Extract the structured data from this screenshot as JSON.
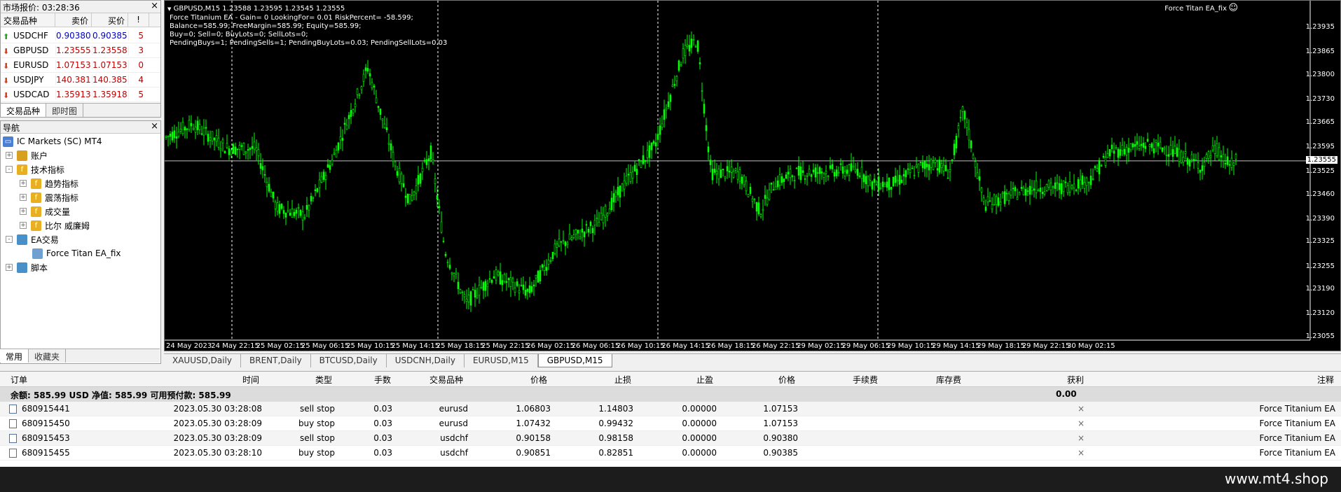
{
  "market_watch": {
    "title": "市场报价: 03:28:36",
    "headers": {
      "symbol": "交易品种",
      "bid": "卖价",
      "ask": "买价",
      "spread": "!"
    },
    "rows": [
      {
        "symbol": "USDCHF",
        "bid": "0.90380",
        "ask": "0.90385",
        "spread": "5",
        "dir": "up"
      },
      {
        "symbol": "GBPUSD",
        "bid": "1.23555",
        "ask": "1.23558",
        "spread": "3",
        "dir": "down"
      },
      {
        "symbol": "EURUSD",
        "bid": "1.07153",
        "ask": "1.07153",
        "spread": "0",
        "dir": "down"
      },
      {
        "symbol": "USDJPY",
        "bid": "140.381",
        "ask": "140.385",
        "spread": "4",
        "dir": "down"
      },
      {
        "symbol": "USDCAD",
        "bid": "1.35913",
        "ask": "1.35918",
        "spread": "5",
        "dir": "down"
      }
    ],
    "tabs": [
      "交易品种",
      "即时图"
    ]
  },
  "navigator": {
    "title": "导航",
    "items": [
      {
        "label": "IC Markets (SC) MT4",
        "level": 0
      },
      {
        "label": "账户",
        "level": 1
      },
      {
        "label": "技术指标",
        "level": 1
      },
      {
        "label": "趋势指标",
        "level": 2
      },
      {
        "label": "震荡指标",
        "level": 2
      },
      {
        "label": "成交量",
        "level": 2
      },
      {
        "label": "比尔 威廉姆",
        "level": 2
      },
      {
        "label": "EA交易",
        "level": 1
      },
      {
        "label": "Force Titan EA_fix",
        "level": 2
      },
      {
        "label": "脚本",
        "level": 1
      }
    ],
    "tabs": [
      "常用",
      "收藏夹"
    ]
  },
  "chart": {
    "symbol_line": "GBPUSD,M15  1.23588 1.23595 1.23545 1.23555",
    "info_lines": [
      "Force Titanium EA - Gain= 0 LookingFor= 0.01 RiskPercent= -58.599;",
      "Balance=585.99; FreeMargin=585.99; Equity=585.99;",
      "Buy=0; Sell=0; BuyLots=0; SellLots=0;",
      "PendingBuys=1; PendingSells=1; PendingBuyLots=0.03; PendingSellLots=0.03"
    ],
    "ea_label": "Force Titan EA_fix",
    "smiley": "☺",
    "price_labels": [
      "1.23935",
      "1.23865",
      "1.23800",
      "1.23730",
      "1.23665",
      "1.23595",
      "1.23525",
      "1.23460",
      "1.23390",
      "1.23325",
      "1.23255",
      "1.23190",
      "1.23120",
      "1.23055"
    ],
    "current_price": "1.23555",
    "time_labels": [
      "24 May 2023",
      "24 May 22:15",
      "25 May 02:15",
      "25 May 06:15",
      "25 May 10:15",
      "25 May 14:15",
      "25 May 18:15",
      "25 May 22:15",
      "26 May 02:15",
      "26 May 06:15",
      "26 May 10:15",
      "26 May 14:15",
      "26 May 18:15",
      "26 May 22:15",
      "29 May 02:15",
      "29 May 06:15",
      "29 May 10:15",
      "29 May 14:15",
      "29 May 18:15",
      "29 May 22:15",
      "30 May 02:15"
    ],
    "colors": {
      "bg": "#000000",
      "candle": "#00ff00",
      "grid": "#ffffff",
      "bidline": "#c0c0c0"
    }
  },
  "chart_tabs": [
    "XAUUSD,Daily",
    "BRENT,Daily",
    "BTCUSD,Daily",
    "USDCNH,Daily",
    "EURUSD,M15",
    "GBPUSD,M15"
  ],
  "terminal": {
    "headers": {
      "order": "订单",
      "time": "时间",
      "type": "类型",
      "lots": "手数",
      "symbol": "交易品种",
      "price": "价格",
      "sl": "止损",
      "tp": "止盈",
      "price2": "价格",
      "commission": "手续费",
      "swap": "库存费",
      "profit": "获利",
      "comment": "注释"
    },
    "summary": "余额: 585.99 USD  净值: 585.99  可用预付款: 585.99",
    "summary_profit": "0.00",
    "rows": [
      {
        "order": "680915441",
        "time": "2023.05.30 03:28:08",
        "type": "sell stop",
        "lots": "0.03",
        "symbol": "eurusd",
        "price": "1.06803",
        "sl": "1.14803",
        "tp": "0.00000",
        "price2": "1.07153",
        "comment": "Force Titanium EA"
      },
      {
        "order": "680915450",
        "time": "2023.05.30 03:28:09",
        "type": "buy stop",
        "lots": "0.03",
        "symbol": "eurusd",
        "price": "1.07432",
        "sl": "0.99432",
        "tp": "0.00000",
        "price2": "1.07153",
        "comment": "Force Titanium EA"
      },
      {
        "order": "680915453",
        "time": "2023.05.30 03:28:09",
        "type": "sell stop",
        "lots": "0.03",
        "symbol": "usdchf",
        "price": "0.90158",
        "sl": "0.98158",
        "tp": "0.00000",
        "price2": "0.90380",
        "comment": "Force Titanium EA"
      },
      {
        "order": "680915455",
        "time": "2023.05.30 03:28:10",
        "type": "buy stop",
        "lots": "0.03",
        "symbol": "usdchf",
        "price": "0.90851",
        "sl": "0.82851",
        "tp": "0.00000",
        "price2": "0.90385",
        "comment": "Force Titanium EA"
      }
    ]
  },
  "brand": "www.mt4.shop"
}
